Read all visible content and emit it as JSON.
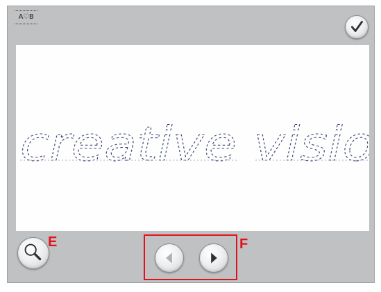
{
  "header": {
    "font_label": "A♡B"
  },
  "preview": {
    "text": "creative vision",
    "stitch_color": "#3d4a72"
  },
  "controls": {
    "confirm_icon": "checkmark-icon",
    "zoom_icon": "magnifier-icon",
    "prev_icon": "arrow-left-icon",
    "next_icon": "arrow-right-icon"
  },
  "callouts": {
    "zoom_letter": "E",
    "nav_letter": "F",
    "color": "#e2121c"
  },
  "colors": {
    "panel": "#bfc1c3",
    "preview_bg": "#fefefe"
  }
}
